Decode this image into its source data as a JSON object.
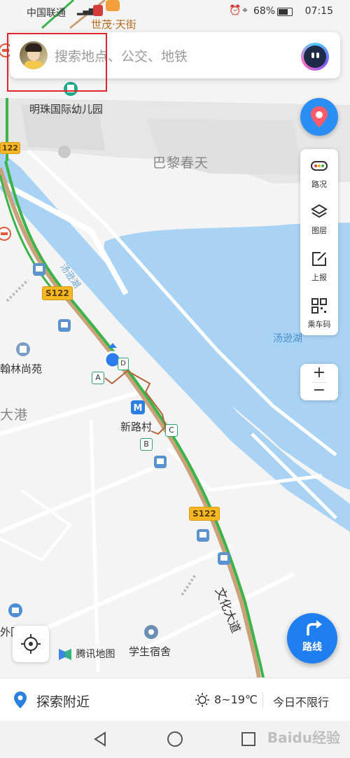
{
  "status_bar": {
    "carrier": "中国联通",
    "battery": "68%",
    "time": "07:15"
  },
  "search": {
    "placeholder": "搜索地点、公交、地铁"
  },
  "map": {
    "labels": {
      "top_poi": "世茂·天街",
      "kindergarten": "明珠国际幼儿园",
      "area_bali": "巴黎春天",
      "river": "汤逊湖",
      "lake": "汤逊湖",
      "hanlin": "翰林尚苑",
      "dagang": "大港",
      "station": "新路村",
      "dorm": "学生宿舍",
      "road": "文化大道",
      "left_edge": "外国语"
    },
    "road_shields": [
      "S122",
      "S122"
    ],
    "exit_markers": [
      "A",
      "B",
      "C",
      "D"
    ],
    "left_badge": "122"
  },
  "toolbar": {
    "traffic_label": "路况",
    "layers_label": "图层",
    "report_label": "上报",
    "bus_code_label": "乘车码"
  },
  "zoom": {
    "plus": "+",
    "minus": "−"
  },
  "brand": {
    "logo_text": "腾讯地图"
  },
  "route_button": {
    "label": "路线"
  },
  "bottom": {
    "explore": "探索附近",
    "temperature": "8~19℃",
    "traffic_limit": "今日不限行"
  },
  "watermark": "Baidu经验"
}
